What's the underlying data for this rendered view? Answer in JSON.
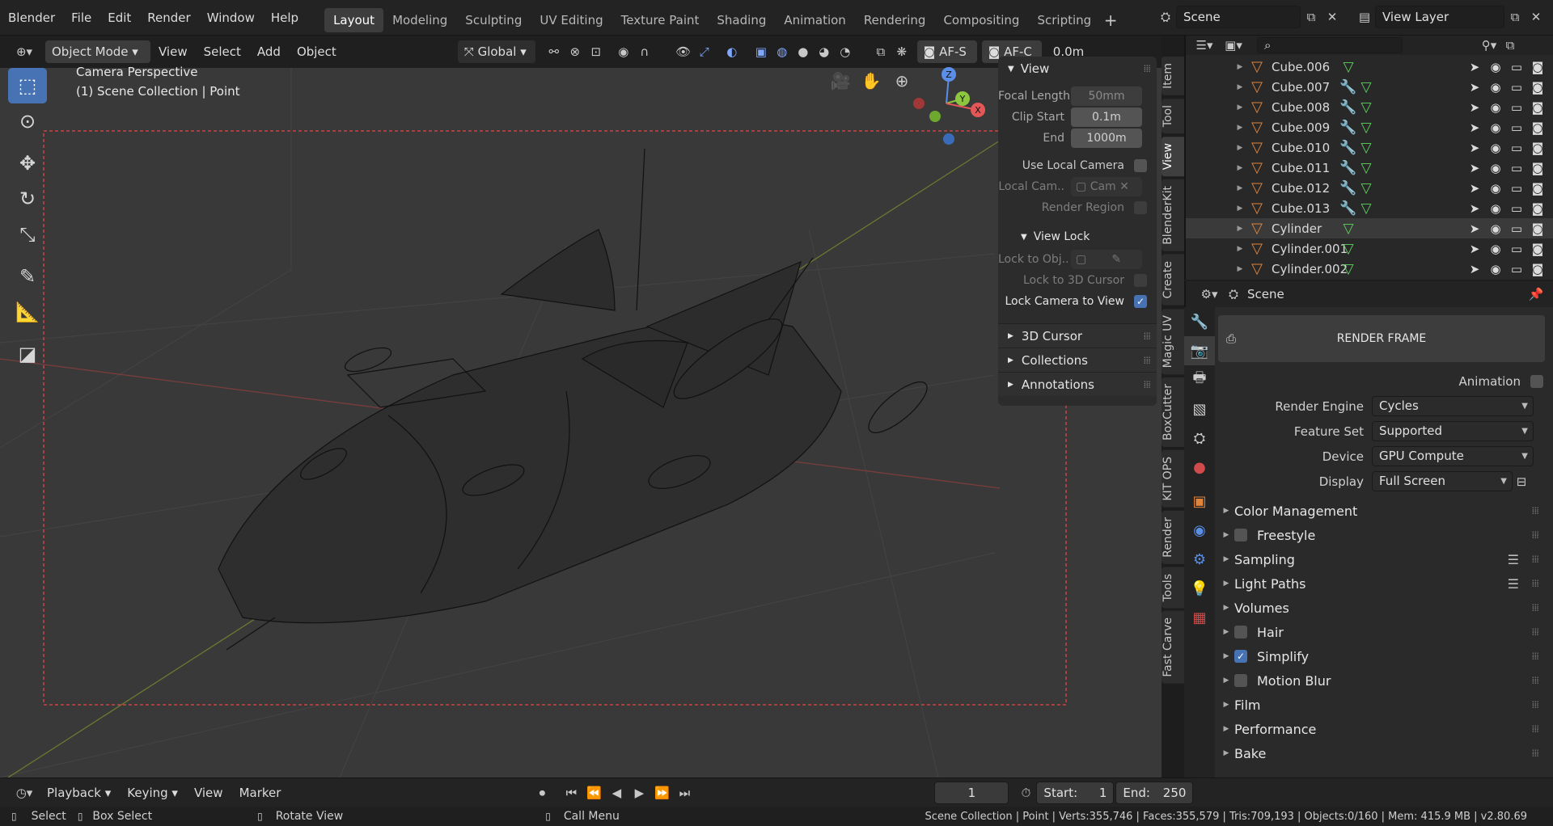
{
  "topbar": {
    "menus": [
      "Blender",
      "File",
      "Edit",
      "Render",
      "Window",
      "Help"
    ],
    "workspaces": [
      "Layout",
      "Modeling",
      "Sculpting",
      "UV Editing",
      "Texture Paint",
      "Shading",
      "Animation",
      "Rendering",
      "Compositing",
      "Scripting"
    ],
    "active_workspace": "Layout",
    "scene_name": "Scene",
    "view_layer": "View Layer"
  },
  "viewport_header": {
    "mode": "Object Mode",
    "menus": [
      "View",
      "Select",
      "Add",
      "Object"
    ],
    "orientation": "Global",
    "af_s": "AF-S",
    "af_c": "AF-C",
    "offset": "0.0m"
  },
  "viewport": {
    "overlay_line1": "Camera Perspective",
    "overlay_line2": "(1) Scene Collection | Point",
    "gizmo": {
      "z": "Z",
      "y": "Y",
      "x": "X"
    }
  },
  "npanel": {
    "view_header": "View",
    "focal_length_label": "Focal Length",
    "focal_length": "50mm",
    "clip_start_label": "Clip Start",
    "clip_start": "0.1m",
    "clip_end_label": "End",
    "clip_end": "1000m",
    "use_local_camera": "Use Local Camera",
    "local_camera_label": "Local Cam..",
    "local_camera_value": "Cam",
    "render_region": "Render Region",
    "view_lock_header": "View Lock",
    "lock_to_obj": "Lock to Obj..",
    "lock_to_cursor": "Lock to 3D Cursor",
    "lock_camera": "Lock Camera to View",
    "sections": [
      "3D Cursor",
      "Collections",
      "Annotations"
    ]
  },
  "vtabs": [
    "Item",
    "Tool",
    "View",
    "BlenderKit",
    "Create",
    "Magic UV",
    "BoxCutter",
    "KIT OPS",
    "Render",
    "Tools",
    "Fast Carve"
  ],
  "outliner": {
    "rows": [
      {
        "name": "Cube.006",
        "mod": false
      },
      {
        "name": "Cube.007",
        "mod": true
      },
      {
        "name": "Cube.008",
        "mod": true
      },
      {
        "name": "Cube.009",
        "mod": true
      },
      {
        "name": "Cube.010",
        "mod": true
      },
      {
        "name": "Cube.011",
        "mod": true
      },
      {
        "name": "Cube.012",
        "mod": true
      },
      {
        "name": "Cube.013",
        "mod": true
      },
      {
        "name": "Cylinder",
        "mod": false
      },
      {
        "name": "Cylinder.001",
        "mod": false
      },
      {
        "name": "Cylinder.002",
        "mod": false
      }
    ]
  },
  "properties": {
    "header": "Scene",
    "render_frame": "RENDER FRAME",
    "animation_label": "Animation",
    "render_engine_label": "Render Engine",
    "render_engine": "Cycles",
    "feature_set_label": "Feature Set",
    "feature_set": "Supported",
    "device_label": "Device",
    "device": "GPU Compute",
    "display_label": "Display",
    "display": "Full Screen",
    "sections": [
      {
        "label": "Color Management",
        "check": null,
        "list": false
      },
      {
        "label": "Freestyle",
        "check": false,
        "list": false
      },
      {
        "label": "Sampling",
        "check": null,
        "list": true
      },
      {
        "label": "Light Paths",
        "check": null,
        "list": true
      },
      {
        "label": "Volumes",
        "check": null,
        "list": false
      },
      {
        "label": "Hair",
        "check": false,
        "list": false
      },
      {
        "label": "Simplify",
        "check": true,
        "list": false
      },
      {
        "label": "Motion Blur",
        "check": false,
        "list": false
      },
      {
        "label": "Film",
        "check": null,
        "list": false
      },
      {
        "label": "Performance",
        "check": null,
        "list": false
      },
      {
        "label": "Bake",
        "check": null,
        "list": false
      }
    ]
  },
  "timeline": {
    "menus": [
      "Playback",
      "Keying",
      "View",
      "Marker"
    ],
    "current_frame": "1",
    "start_label": "Start:",
    "start": "1",
    "end_label": "End:",
    "end": "250"
  },
  "statusbar": {
    "select": "Select",
    "box_select": "Box Select",
    "rotate_view": "Rotate View",
    "call_menu": "Call Menu",
    "stats": "Scene Collection | Point | Verts:355,746 | Faces:355,579 | Tris:709,193 | Objects:0/160 | Mem: 415.9 MB | v2.80.69"
  },
  "colors": {
    "accent": "#4772b3",
    "object": "#e0843c",
    "mesh": "#5fd35f",
    "modifier": "#7fa8ff"
  }
}
